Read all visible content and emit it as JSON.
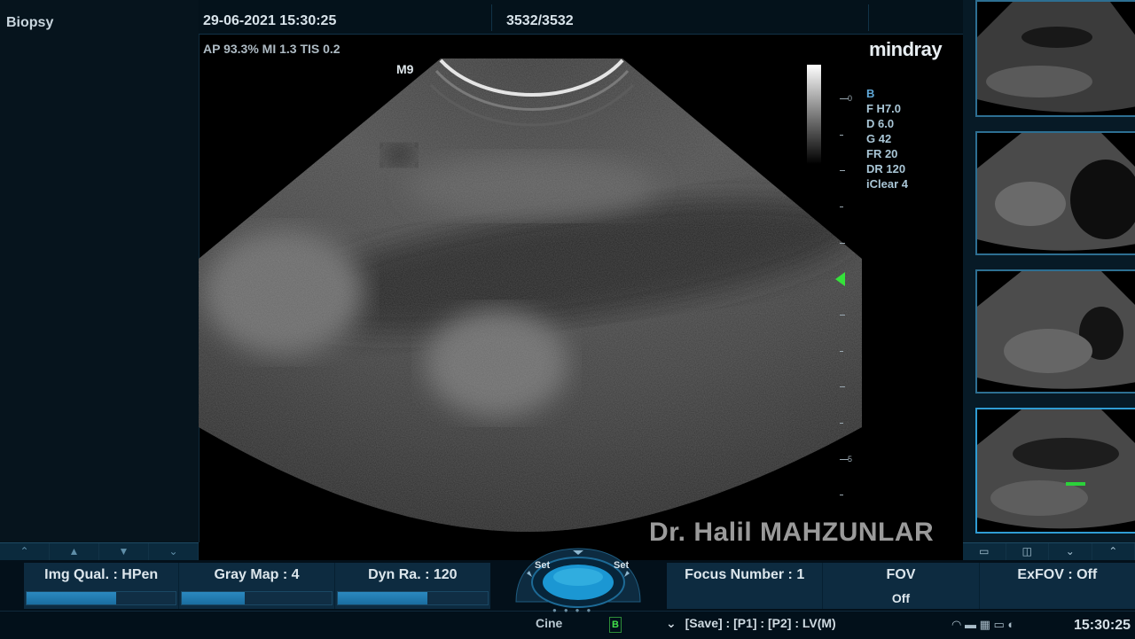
{
  "left_panel": {
    "title": "Biopsy"
  },
  "header": {
    "datetime": "29-06-2021 15:30:25",
    "frame": "3532/3532"
  },
  "acoustic": "AP 93.3%  MI 1.3  TIS 0.2",
  "brand": "mindray",
  "probe": "M9",
  "depth_scale": {
    "labels": [
      "0",
      "5"
    ]
  },
  "params": {
    "mode": "B",
    "lines": [
      "F H7.0",
      "D 6.0",
      "G 42",
      "FR 20",
      "DR 120",
      "iClear 4"
    ]
  },
  "watermark": "Dr. Halil MAHZUNLAR",
  "left_menu": [
    {
      "label": "Img Qual. : HPen",
      "level": 0.6
    },
    {
      "label": "Gray Map : 4",
      "level": 0.42
    },
    {
      "label": "Dyn Ra. : 120",
      "level": 0.6
    }
  ],
  "trackball": {
    "left": "Set",
    "right": "Set"
  },
  "right_menu": [
    {
      "label": "Focus Number : 1",
      "sub": ""
    },
    {
      "label": "FOV",
      "sub": "Off"
    },
    {
      "label": "ExFOV : Off",
      "sub": ""
    }
  ],
  "status": {
    "cine": "Cine",
    "mode_indicator": "B",
    "text": "[Save] :      [P1] :      [P2] : LV(M)"
  },
  "clock": "15:30:25",
  "colors": {
    "accent": "#2f9cd3",
    "focus_marker": "#35e23a",
    "panel": "#0d2b40"
  }
}
